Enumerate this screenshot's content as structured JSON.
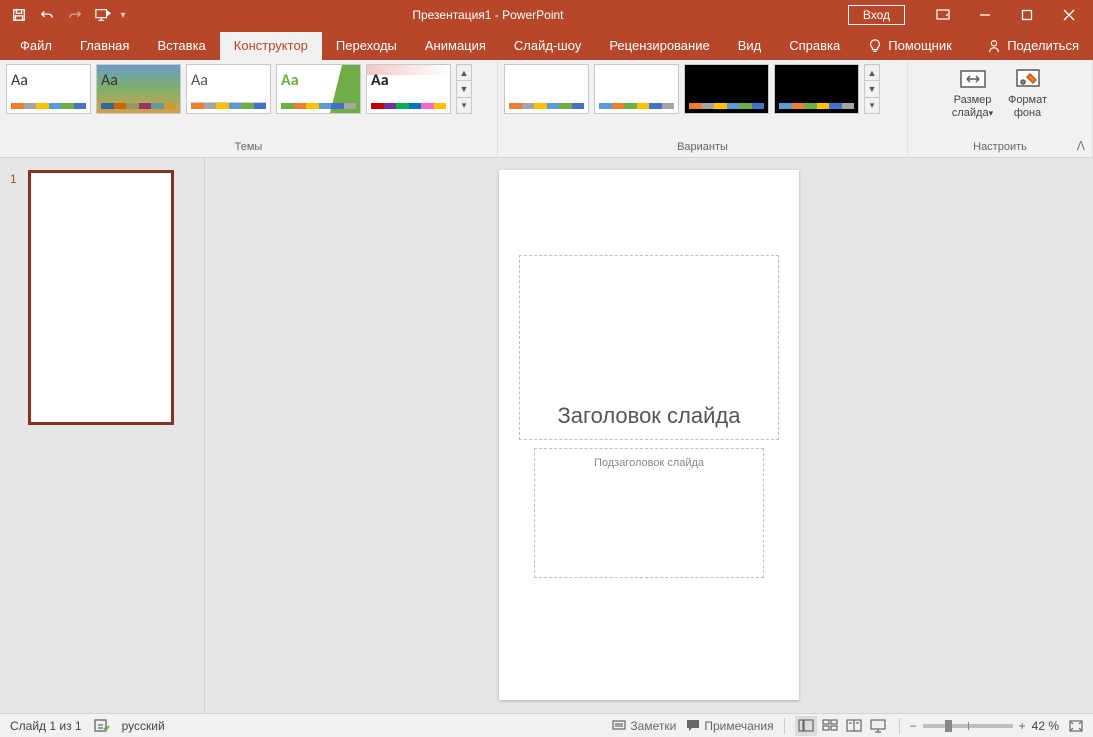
{
  "titlebar": {
    "title": "Презентация1 - PowerPoint",
    "login": "Вход"
  },
  "tabs": {
    "file": "Файл",
    "home": "Главная",
    "insert": "Вставка",
    "design": "Конструктор",
    "transitions": "Переходы",
    "animations": "Анимация",
    "slideshow": "Слайд-шоу",
    "review": "Рецензирование",
    "view": "Вид",
    "help": "Справка",
    "tellme": "Помощник",
    "share": "Поделиться"
  },
  "ribbon": {
    "themes_label": "Темы",
    "variants_label": "Варианты",
    "configure_label": "Настроить",
    "slide_size": "Размер слайда",
    "format_bg": "Формат фона",
    "aa": "Aa"
  },
  "slide": {
    "title_placeholder": "Заголовок слайда",
    "subtitle_placeholder": "Подзаголовок слайда",
    "thumb_number": "1"
  },
  "status": {
    "slide_info": "Слайд 1 из 1",
    "language": "русский",
    "notes": "Заметки",
    "comments": "Примечания",
    "zoom": "42 %"
  }
}
